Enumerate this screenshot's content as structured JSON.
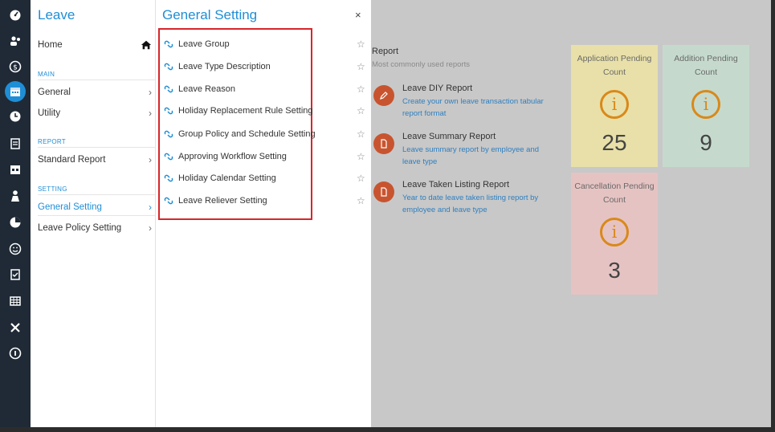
{
  "rail": {
    "icons": [
      "dashboard-icon",
      "users-icon",
      "payroll-icon",
      "calendar-icon",
      "clock-icon",
      "document-icon",
      "schedule-icon",
      "person-icon",
      "pie-chart-icon",
      "smile-icon",
      "checklist-icon",
      "table-icon",
      "tools-icon",
      "info-icon"
    ],
    "active_index": 3
  },
  "menu": {
    "title": "Leave",
    "home_label": "Home",
    "sections": {
      "main": "MAIN",
      "report": "REPORT",
      "setting": "SETTING"
    },
    "items": {
      "general": "General",
      "utility": "Utility",
      "standard_report": "Standard Report",
      "general_setting": "General Setting",
      "leave_policy_setting": "Leave Policy Setting"
    }
  },
  "general_setting": {
    "title": "General Setting",
    "close": "×",
    "items": [
      "Leave Group",
      "Leave Type Description",
      "Leave Reason",
      "Holiday Replacement Rule Setting",
      "Group Policy and Schedule Setting",
      "Approving Workflow Setting",
      "Holiday Calendar Setting",
      "Leave Reliever Setting"
    ]
  },
  "report": {
    "title": "Report",
    "subtitle": "Most commonly used reports",
    "items": [
      {
        "name": "Leave DIY Report",
        "desc": "Create your own leave transaction tabular report format",
        "icon": "pencil-icon"
      },
      {
        "name": "Leave Summary Report",
        "desc": "Leave summary report by employee and leave type",
        "icon": "file-icon"
      },
      {
        "name": "Leave Taken Listing Report",
        "desc": "Year to date leave taken listing report by employee and leave type",
        "icon": "file-icon"
      }
    ]
  },
  "cards": [
    {
      "title": "Application Pending Count",
      "value": "25",
      "color": "#e8e0a8"
    },
    {
      "title": "Addition Pending Count",
      "value": "9",
      "color": "#c5dacd"
    },
    {
      "title": "Cancellation Pending Count",
      "value": "3",
      "color": "#e6c3c3"
    }
  ],
  "colors": {
    "accent": "#1f8ed6",
    "highlight_box": "#d7262b",
    "rail_bg": "#1f2a36",
    "report_icon": "#c8542f",
    "info_icon": "#d9891a"
  }
}
